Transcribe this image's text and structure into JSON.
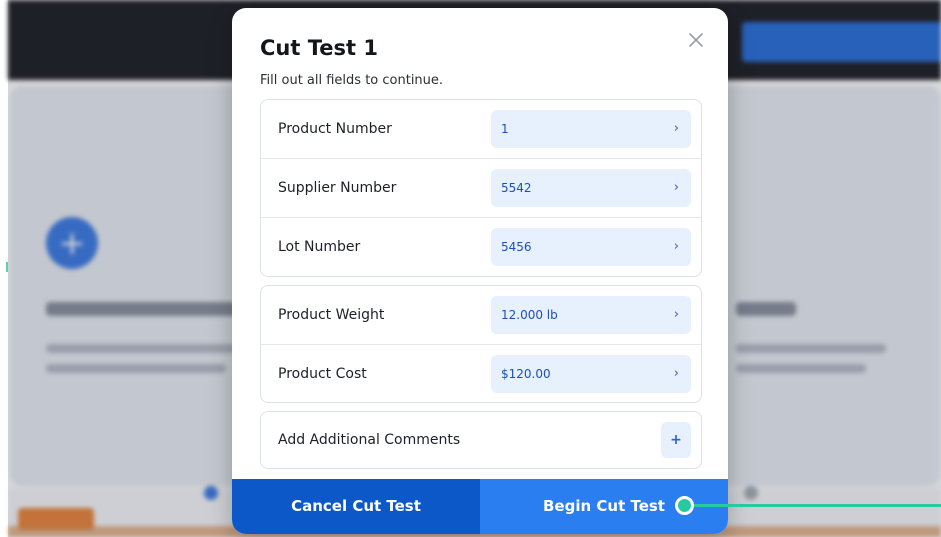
{
  "modal": {
    "title": "Cut Test 1",
    "subtitle": "Fill out all fields to continue.",
    "close_icon": "close-icon"
  },
  "identification_fields": [
    {
      "label": "Product Number",
      "value": "1",
      "chevron": "›"
    },
    {
      "label": "Supplier Number",
      "value": "5542",
      "chevron": "›"
    },
    {
      "label": "Lot Number",
      "value": "5456",
      "chevron": "›"
    }
  ],
  "product_fields": [
    {
      "label": "Product Weight",
      "value": "12.000 lb",
      "chevron": "›"
    },
    {
      "label": "Product Cost",
      "value": "$120.00",
      "chevron": "›"
    }
  ],
  "comments": {
    "label": "Add Additional Comments",
    "add_symbol": "+"
  },
  "footer": {
    "cancel_label": "Cancel Cut Test",
    "begin_label": "Begin Cut Test"
  },
  "background": {
    "plus_symbol": "+",
    "colors": {
      "topbar": "#1f2026",
      "accent_blue": "#2a7ef0",
      "dark_blue": "#0d58c9",
      "callout_green": "#27c9a1",
      "value_bg": "#e7f0fd"
    }
  }
}
